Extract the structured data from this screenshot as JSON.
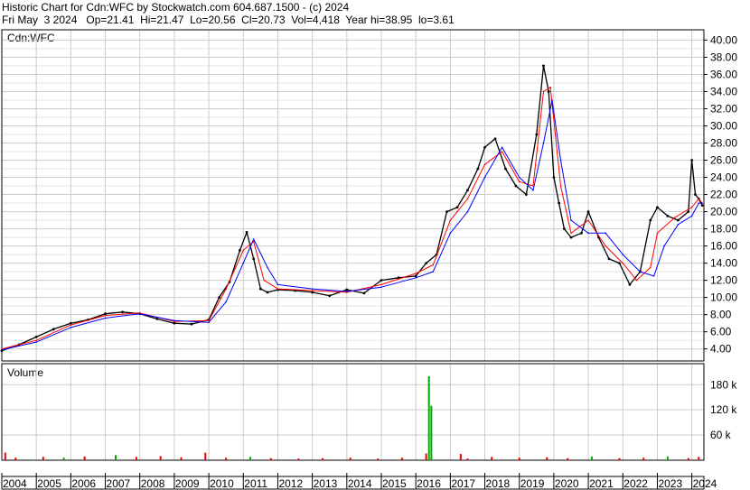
{
  "header": {
    "title": "Historic Chart for Cdn:WFC by Stockwatch.com 604.687.1500 - (c) 2024",
    "summary": "Fri May  3 2024   Op=21.41  Hi=21.47  Lo=20.56  Cl=20.73  Vol=4,418  Year hi=38.95  lo=3.61"
  },
  "colors": {
    "price": "#000000",
    "ma_short": "#ff0000",
    "ma_long": "#0000ff",
    "volume_up": "#00aa00",
    "volume_down": "#ee0000",
    "grid": "#cccccc",
    "frame": "#000000"
  },
  "chart_data": [
    {
      "type": "line",
      "label": "Cdn:WFC",
      "y_ticks": [
        "40.00",
        "38.00",
        "36.00",
        "34.00",
        "32.00",
        "30.00",
        "28.00",
        "26.00",
        "24.00",
        "22.00",
        "20.00",
        "18.00",
        "16.00",
        "14.00",
        "12.00",
        "10.00",
        "8.00",
        "6.00",
        "4.00"
      ],
      "ylim": [
        2.6,
        41.2
      ],
      "x_ticks": [
        "2004",
        "2005",
        "2006",
        "2007",
        "2008",
        "2009",
        "2010",
        "2011",
        "2012",
        "2013",
        "2014",
        "2015",
        "2016",
        "2017",
        "2018",
        "2019",
        "2020",
        "2021",
        "2022",
        "2023",
        "2024"
      ],
      "xlim": [
        2004.0,
        2024.35
      ],
      "grid": true,
      "series": [
        {
          "style": "price",
          "x": [
            2004.0,
            2004.5,
            2005.0,
            2005.5,
            2006.0,
            2006.5,
            2007.0,
            2007.5,
            2008.0,
            2008.5,
            2009.0,
            2009.5,
            2010.0,
            2010.3,
            2010.6,
            2010.9,
            2011.1,
            2011.3,
            2011.5,
            2011.7,
            2012.0,
            2012.5,
            2013.0,
            2013.5,
            2014.0,
            2014.5,
            2015.0,
            2015.5,
            2016.0,
            2016.3,
            2016.6,
            2016.9,
            2017.2,
            2017.5,
            2017.8,
            2018.0,
            2018.3,
            2018.6,
            2018.9,
            2019.2,
            2019.5,
            2019.7,
            2019.85,
            2020.0,
            2020.15,
            2020.3,
            2020.5,
            2020.8,
            2021.0,
            2021.3,
            2021.6,
            2021.9,
            2022.2,
            2022.5,
            2022.8,
            2023.0,
            2023.3,
            2023.6,
            2023.9,
            2024.0,
            2024.1,
            2024.2,
            2024.3
          ],
          "y": [
            3.8,
            4.5,
            5.4,
            6.3,
            7.0,
            7.4,
            8.1,
            8.3,
            8.1,
            7.5,
            7.0,
            6.9,
            7.4,
            10.0,
            11.8,
            15.5,
            17.6,
            14.5,
            11.0,
            10.6,
            10.9,
            10.8,
            10.6,
            10.2,
            10.9,
            10.5,
            12.0,
            12.3,
            12.5,
            14.0,
            15.0,
            20.0,
            20.5,
            22.5,
            25.0,
            27.5,
            28.5,
            25.0,
            23.0,
            22.0,
            29.0,
            37.0,
            34.0,
            24.0,
            21.0,
            18.0,
            17.0,
            17.5,
            20.0,
            17.0,
            14.5,
            14.0,
            11.5,
            13.0,
            19.0,
            20.5,
            19.5,
            19.0,
            20.0,
            26.0,
            22.0,
            21.5,
            20.73
          ]
        },
        {
          "style": "ma_short",
          "x": [
            2004.0,
            2005.0,
            2006.0,
            2007.0,
            2008.0,
            2009.0,
            2010.0,
            2010.5,
            2011.0,
            2011.3,
            2011.6,
            2012.0,
            2013.0,
            2014.0,
            2015.0,
            2016.0,
            2016.5,
            2017.0,
            2017.5,
            2018.0,
            2018.5,
            2019.0,
            2019.4,
            2019.7,
            2019.9,
            2020.2,
            2020.5,
            2021.0,
            2021.5,
            2022.0,
            2022.4,
            2022.8,
            2023.0,
            2023.5,
            2024.0,
            2024.2,
            2024.3
          ],
          "y": [
            4.0,
            5.0,
            6.8,
            7.9,
            8.2,
            7.2,
            7.3,
            11.0,
            15.5,
            16.5,
            12.0,
            11.0,
            10.8,
            10.6,
            11.5,
            12.8,
            13.8,
            19.0,
            21.5,
            25.5,
            27.0,
            23.5,
            23.0,
            34.0,
            34.5,
            23.0,
            17.5,
            19.0,
            16.0,
            14.0,
            12.0,
            13.5,
            17.5,
            19.3,
            20.5,
            21.5,
            21.0
          ]
        },
        {
          "style": "ma_long",
          "x": [
            2004.0,
            2005.0,
            2006.0,
            2007.0,
            2008.0,
            2009.0,
            2010.0,
            2010.5,
            2011.0,
            2011.3,
            2011.7,
            2012.0,
            2013.0,
            2014.0,
            2015.0,
            2016.0,
            2016.5,
            2017.0,
            2017.5,
            2018.0,
            2018.5,
            2019.0,
            2019.4,
            2019.7,
            2019.95,
            2020.2,
            2020.5,
            2021.0,
            2021.5,
            2022.0,
            2022.5,
            2022.9,
            2023.2,
            2023.6,
            2024.0,
            2024.2,
            2024.3
          ],
          "y": [
            3.9,
            4.8,
            6.5,
            7.6,
            8.1,
            7.3,
            7.1,
            9.5,
            14.0,
            16.8,
            13.5,
            11.5,
            11.0,
            10.7,
            11.2,
            12.3,
            13.0,
            17.5,
            20.0,
            24.0,
            27.5,
            24.0,
            22.5,
            28.0,
            33.0,
            26.0,
            19.0,
            17.5,
            17.5,
            15.0,
            13.0,
            12.5,
            16.0,
            18.5,
            19.5,
            21.0,
            21.0
          ]
        }
      ]
    },
    {
      "type": "bar",
      "label": "Volume",
      "y_ticks": [
        "180 k",
        "120 k",
        "60 k"
      ],
      "ylim": [
        0,
        230
      ],
      "series": [
        {
          "style": "volume",
          "x": [
            2004.1,
            2004.4,
            2005.2,
            2005.8,
            2006.4,
            2007.3,
            2007.9,
            2008.6,
            2009.2,
            2009.9,
            2010.5,
            2011.2,
            2011.8,
            2012.6,
            2013.3,
            2014.1,
            2014.9,
            2015.6,
            2016.3,
            2016.38,
            2016.45,
            2017.3,
            2017.5,
            2018.2,
            2019.0,
            2019.8,
            2020.4,
            2021.1,
            2021.9,
            2022.6,
            2023.3,
            2023.9,
            2024.2
          ],
          "y": [
            18,
            6,
            8,
            6,
            9,
            12,
            8,
            10,
            7,
            18,
            6,
            8,
            5,
            4,
            5,
            6,
            4,
            6,
            16,
            200,
            130,
            15,
            4,
            8,
            6,
            7,
            5,
            9,
            5,
            6,
            9,
            5,
            8
          ],
          "up": [
            false,
            false,
            false,
            true,
            false,
            true,
            false,
            false,
            false,
            false,
            false,
            true,
            false,
            false,
            false,
            false,
            false,
            false,
            false,
            true,
            true,
            false,
            false,
            false,
            false,
            false,
            false,
            true,
            false,
            false,
            true,
            false,
            false
          ]
        }
      ]
    }
  ]
}
